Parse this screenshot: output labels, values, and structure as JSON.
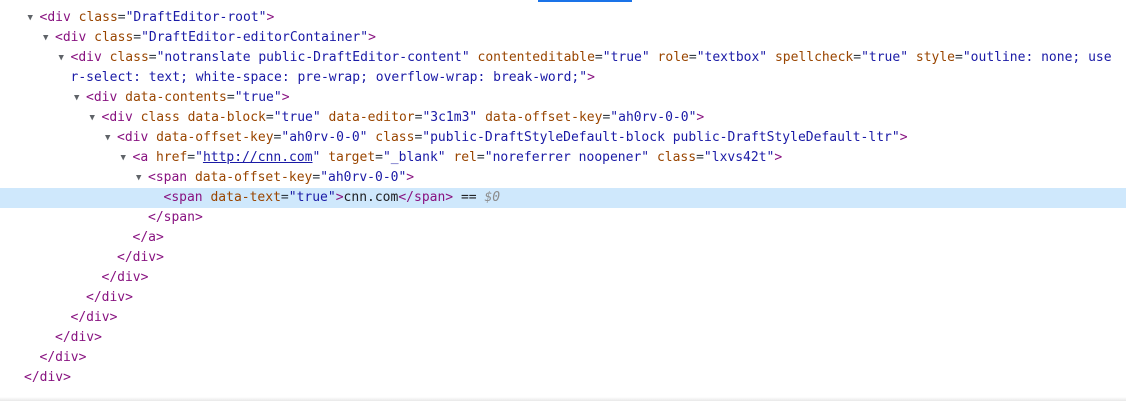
{
  "colors": {
    "tag": "#881280",
    "attr_name": "#994500",
    "attr_value": "#1a1aa6",
    "selection": "#cfe8fc",
    "accent": "#1a73e8"
  },
  "icons": {
    "expanded": "expand-triangle-icon"
  },
  "nodes": [
    {
      "depth": 1,
      "expanded": true,
      "tag_open": "<div",
      "attrs": [
        {
          "name": "class",
          "value": "\"DraftEditor-root\""
        }
      ],
      "tag_close": ">"
    },
    {
      "depth": 2,
      "expanded": true,
      "tag_open": "<div",
      "attrs": [
        {
          "name": "class",
          "value": "\"DraftEditor-editorContainer\""
        }
      ],
      "tag_close": ">"
    },
    {
      "depth": 3,
      "expanded": true,
      "wrap": true,
      "tag_open": "<div",
      "attrs": [
        {
          "name": "class",
          "value": "\"notranslate public-DraftEditor-content\""
        },
        {
          "name": "contenteditable",
          "value": "\"true\""
        },
        {
          "name": "role",
          "value": "\"textbox\""
        },
        {
          "name": "spellcheck",
          "value": "\"true\""
        },
        {
          "name": "style",
          "value": "\"outline: none; user-select: text; white-space: pre-wrap; overflow-wrap: break-word;\""
        }
      ],
      "tag_close": ">"
    },
    {
      "depth": 4,
      "expanded": true,
      "tag_open": "<div",
      "attrs": [
        {
          "name": "data-contents",
          "value": "\"true\""
        }
      ],
      "tag_close": ">"
    },
    {
      "depth": 5,
      "expanded": true,
      "tag_open": "<div",
      "attrs": [
        {
          "name": "class",
          "value": null
        },
        {
          "name": "data-block",
          "value": "\"true\""
        },
        {
          "name": "data-editor",
          "value": "\"3c1m3\""
        },
        {
          "name": "data-offset-key",
          "value": "\"ah0rv-0-0\""
        }
      ],
      "tag_close": ">"
    },
    {
      "depth": 6,
      "expanded": true,
      "tag_open": "<div",
      "attrs": [
        {
          "name": "data-offset-key",
          "value": "\"ah0rv-0-0\""
        },
        {
          "name": "class",
          "value": "\"public-DraftStyleDefault-block public-DraftStyleDefault-ltr\""
        }
      ],
      "tag_close": ">"
    },
    {
      "depth": 7,
      "expanded": true,
      "tag_open": "<a",
      "attrs": [
        {
          "name": "href",
          "value": "\"http://cnn.com\"",
          "link": true
        },
        {
          "name": "target",
          "value": "\"_blank\""
        },
        {
          "name": "rel",
          "value": "\"noreferrer noopener\""
        },
        {
          "name": "class",
          "value": "\"lxvs42t\""
        }
      ],
      "tag_close": ">"
    },
    {
      "depth": 8,
      "expanded": true,
      "tag_open": "<span",
      "attrs": [
        {
          "name": "data-offset-key",
          "value": "\"ah0rv-0-0\""
        }
      ],
      "tag_close": ">"
    },
    {
      "depth": 9,
      "selected": true,
      "tag_open": "<span",
      "attrs": [
        {
          "name": "data-text",
          "value": "\"true\""
        }
      ],
      "tag_close": ">",
      "text": "cnn.com",
      "end_tag": "</span>",
      "suffix": " == ",
      "dollar": "$0"
    },
    {
      "depth": 8,
      "end_tag": "</span>"
    },
    {
      "depth": 7,
      "end_tag": "</a>"
    },
    {
      "depth": 6,
      "end_tag": "</div>"
    },
    {
      "depth": 5,
      "end_tag": "</div>"
    },
    {
      "depth": 4,
      "end_tag": "</div>"
    },
    {
      "depth": 3,
      "end_tag": "</div>"
    },
    {
      "depth": 2,
      "end_tag": "</div>"
    },
    {
      "depth": 1,
      "end_tag": "</div>"
    },
    {
      "depth": 0,
      "end_tag": "</div>"
    }
  ]
}
